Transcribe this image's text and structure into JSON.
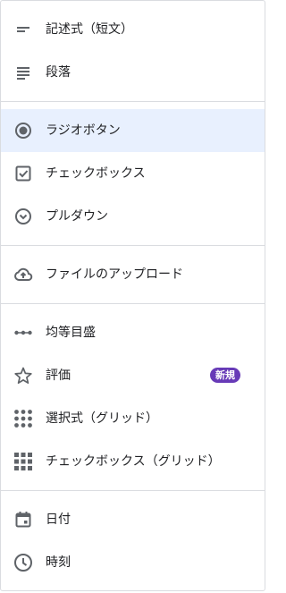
{
  "menu": {
    "items": [
      {
        "label": "記述式（短文）",
        "icon": "short-answer-icon"
      },
      {
        "label": "段落",
        "icon": "paragraph-icon"
      },
      {
        "label": "ラジオボタン",
        "icon": "radio-button-icon",
        "selected": true
      },
      {
        "label": "チェックボックス",
        "icon": "checkbox-icon"
      },
      {
        "label": "プルダウン",
        "icon": "dropdown-icon"
      },
      {
        "label": "ファイルのアップロード",
        "icon": "cloud-upload-icon"
      },
      {
        "label": "均等目盛",
        "icon": "linear-scale-icon"
      },
      {
        "label": "評価",
        "icon": "star-icon",
        "badge": "新規"
      },
      {
        "label": "選択式（グリッド）",
        "icon": "grid-dots-icon"
      },
      {
        "label": "チェックボックス（グリッド）",
        "icon": "grid-squares-icon"
      },
      {
        "label": "日付",
        "icon": "calendar-icon"
      },
      {
        "label": "時刻",
        "icon": "clock-icon"
      }
    ]
  },
  "colors": {
    "icon": "#5f6368",
    "text": "#202124",
    "selected_background": "#e8f0fe",
    "badge": "#673ab7",
    "divider": "#dadce0"
  }
}
